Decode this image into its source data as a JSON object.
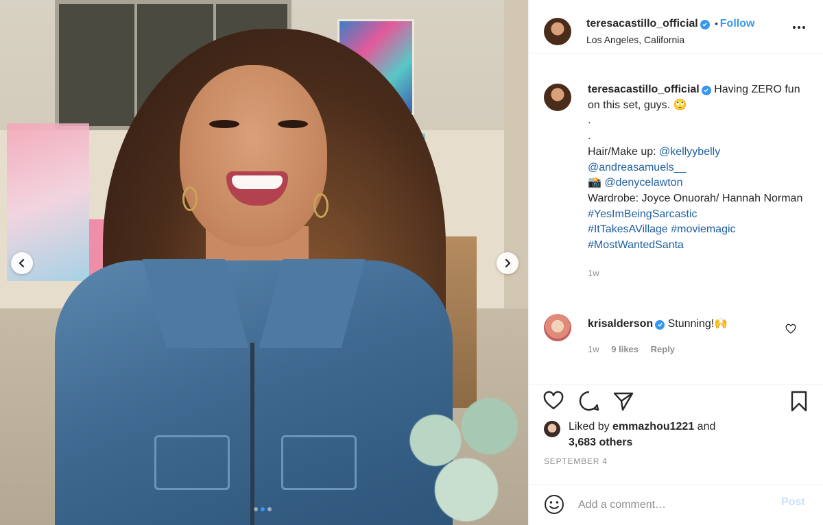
{
  "photo": {
    "prev_icon": "chevron-left-icon",
    "next_icon": "chevron-right-icon",
    "slide_count": 3,
    "active_slide": 2
  },
  "header": {
    "username": "teresacastillo_official",
    "separator": "•",
    "follow_label": "Follow",
    "location": "Los Angeles, California",
    "more_icon": "more-options-icon"
  },
  "caption": {
    "username": "teresacastillo_official",
    "text_line1": "Having ZERO fun on this set, guys.",
    "text_emoji": "🙄",
    "dot1": ".",
    "dot2": ".",
    "hair_makeup_label": "Hair/Make up:",
    "mention1": "@kellyybelly",
    "mention2": "@andreasamuels__",
    "camera_emoji": "📸",
    "mention3": "@denycelawton",
    "wardrobe": "Wardrobe: Joyce Onuorah/ Hannah Norman",
    "hashtag1": "#YesImBeingSarcastic",
    "hashtag2": "#ItTakesAVillage",
    "hashtag3": "#moviemagic",
    "hashtag4": "#MostWantedSanta",
    "time": "1w"
  },
  "comment": {
    "username": "krisalderson",
    "text": "Stunning!",
    "emoji": "🙌",
    "time": "1w",
    "likes": "9 likes",
    "reply_label": "Reply"
  },
  "actions": {
    "like_icon": "heart-icon",
    "comment_icon": "comment-icon",
    "share_icon": "share-icon",
    "save_icon": "bookmark-icon"
  },
  "likes": {
    "prefix": "Liked by",
    "user": "emmazhou1221",
    "and": "and",
    "others": "3,683 others"
  },
  "date": "SEPTEMBER 4",
  "add_comment": {
    "placeholder": "Add a comment…",
    "post_label": "Post",
    "emoji_icon": "smiley-icon"
  },
  "colors": {
    "accent": "#3897f0",
    "link": "#1f5fa0",
    "muted": "#8e8e8e",
    "text": "#262626",
    "post_disabled": "#c7e0fb"
  }
}
